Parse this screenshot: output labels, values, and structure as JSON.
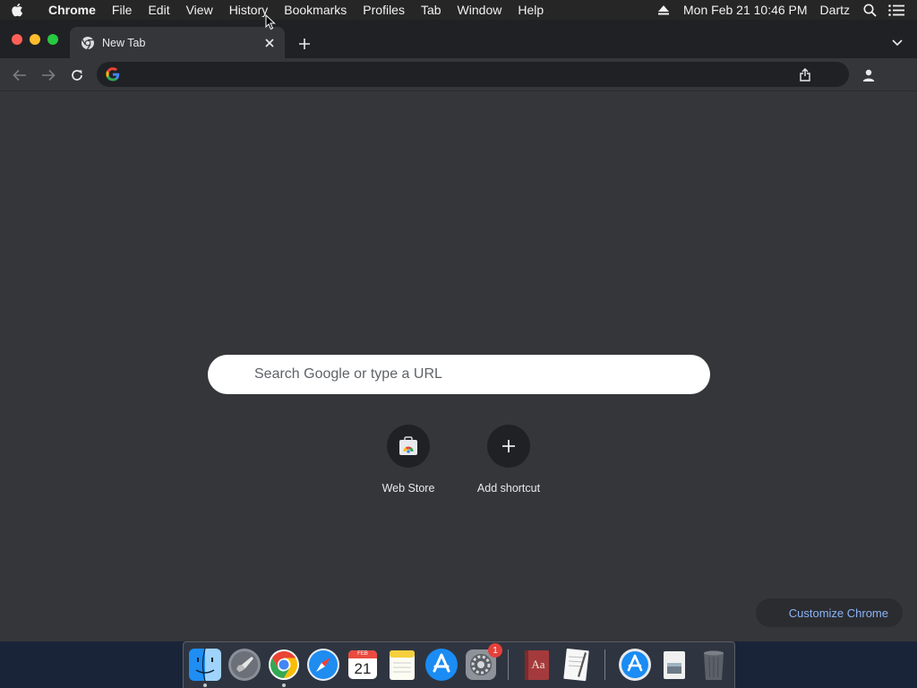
{
  "menubar": {
    "app_name": "Chrome",
    "items": [
      "File",
      "Edit",
      "View",
      "History",
      "Bookmarks",
      "Profiles",
      "Tab",
      "Window",
      "Help"
    ],
    "datetime": "Mon Feb 21  10:46 PM",
    "user": "Dartz",
    "icons": [
      "apple-icon",
      "eject-icon",
      "spotlight-search-icon",
      "notification-center-icon"
    ]
  },
  "window": {
    "tab": {
      "title": "New Tab",
      "favicon": "chrome-icon"
    },
    "omnibox": {
      "value": "",
      "placeholder": ""
    }
  },
  "ntp": {
    "search_placeholder": "Search Google or type a URL",
    "shortcuts": [
      {
        "label": "Web Store",
        "icon": "web-store-icon"
      },
      {
        "label": "Add shortcut",
        "icon": "plus-icon"
      }
    ],
    "customize_label": "Customize Chrome"
  },
  "dock": {
    "apps": [
      {
        "name": "finder",
        "running": true
      },
      {
        "name": "launchpad",
        "running": false
      },
      {
        "name": "chrome",
        "running": true
      },
      {
        "name": "safari",
        "running": false
      },
      {
        "name": "calendar",
        "running": false,
        "month": "FEB",
        "day": "21"
      },
      {
        "name": "notes",
        "running": false
      },
      {
        "name": "app-store",
        "running": false
      },
      {
        "name": "system-preferences",
        "running": false,
        "badge": "1"
      },
      {
        "name": "dictionary",
        "running": false,
        "label": "Aa"
      },
      {
        "name": "textedit",
        "running": false
      },
      {
        "name": "app-store-folder",
        "running": false
      },
      {
        "name": "preview",
        "running": false
      },
      {
        "name": "trash",
        "running": false
      }
    ]
  },
  "colors": {
    "chrome_toolbar": "#35363a",
    "tabstrip": "#202124",
    "link_blue": "#8ab4f8",
    "desktop": "#1a2438"
  }
}
